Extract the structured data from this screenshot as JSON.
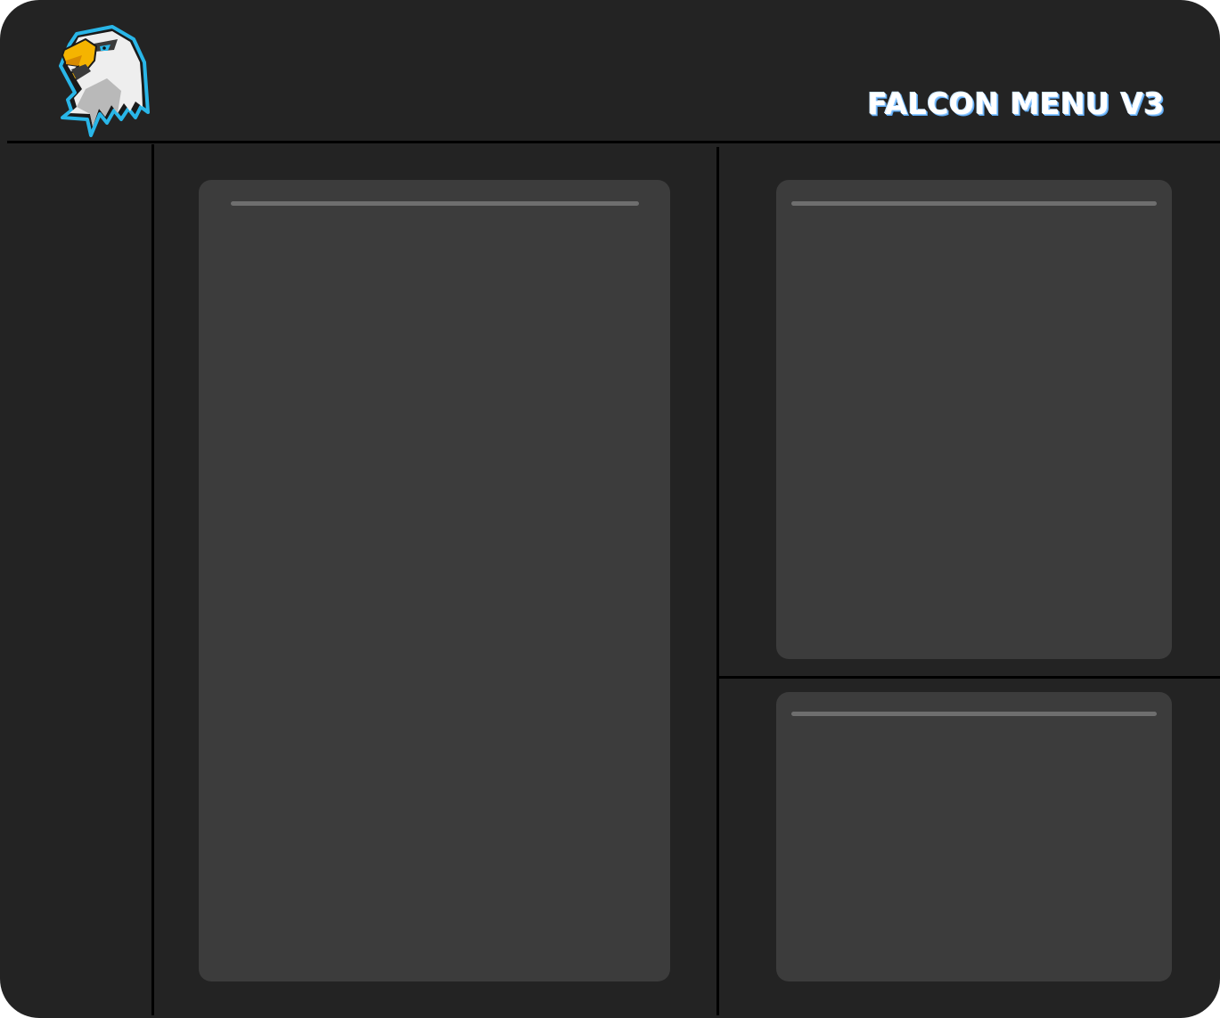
{
  "app": {
    "title": "FALCON MENU V3"
  },
  "colors": {
    "background": "#232323",
    "panel": "#3c3c3c",
    "panel_bar": "#6e6e6e",
    "divider": "#000000",
    "accent": "#29b6e8",
    "beak": "#f5b400"
  },
  "icons": {
    "logo": "eagle-head-logo"
  }
}
